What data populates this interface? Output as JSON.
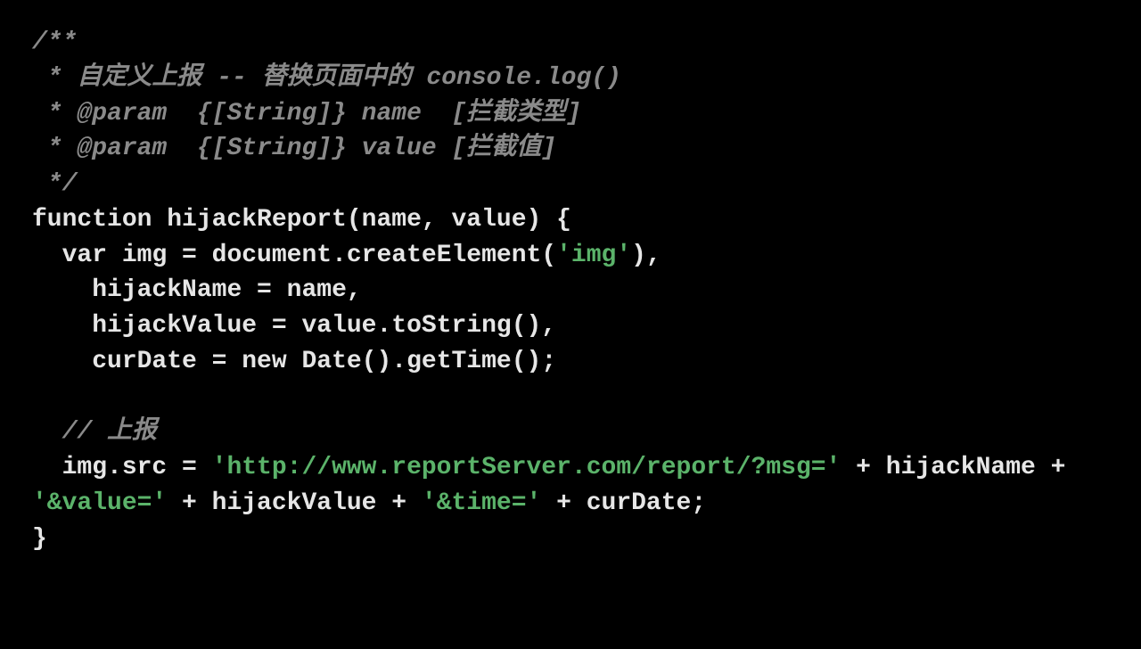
{
  "code": {
    "c_open": "/**",
    "c_l1_a": " * ",
    "c_l1_b": "自定义上报 -- 替换页面中的 console.log()",
    "c_l2_a": " * ",
    "c_l2_tag": "@param",
    "c_l2_b": "  {[String]} name  [拦截类型]",
    "c_l3_a": " * ",
    "c_l3_tag": "@param",
    "c_l3_b": "  {[String]} value [拦截值]",
    "c_close": " */",
    "fn_decl_a": "function",
    "fn_decl_b": " hijackReport(name, value) {",
    "var_a": "  ",
    "var_kw": "var",
    "var_b": " img = document.createElement(",
    "str_img": "'img'",
    "var_c": "),",
    "hn": "    hijackName = name,",
    "hv": "    hijackValue = value.toString(),",
    "cd_a": "    curDate = ",
    "cd_new": "new",
    "cd_b": " Date().getTime();",
    "blank": "",
    "rc_a": "  ",
    "rc_b": "// 上报",
    "src_a": "  img.src = ",
    "str_url": "'http://www.reportServer.com/report/?msg='",
    "src_b": " + hijackName + ",
    "str_val": "'&value='",
    "src_c": " + hijackValue + ",
    "str_time": "'&time='",
    "src_d": " + curDate;",
    "close": "}"
  }
}
